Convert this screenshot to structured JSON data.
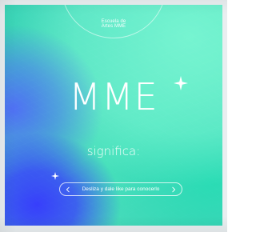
{
  "logo": {
    "line1": "Escuela de",
    "line2": "Artes MME"
  },
  "title": "MME",
  "subtitle": "significa:",
  "cta": {
    "text": "Desliza y dale like para conocerlo"
  },
  "colors": {
    "mint": "#58e0b6",
    "blue": "#3636ff",
    "white": "#ffffff"
  },
  "icons": {
    "sparkle_large": "sparkle-icon",
    "sparkle_small": "sparkle-icon",
    "chevron_left": "chevron-left-icon",
    "chevron_right": "chevron-right-icon"
  }
}
